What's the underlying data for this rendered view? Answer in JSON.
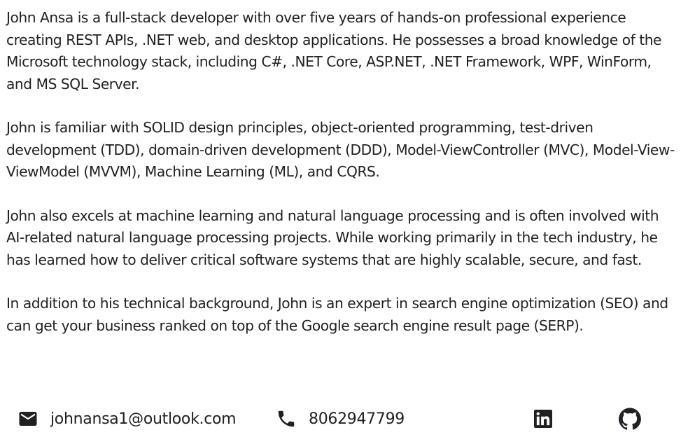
{
  "bio": {
    "paragraphs": [
      "John Ansa is a full-stack developer with over five years of hands-on professional experience creating REST APIs, .NET web, and desktop applications. He possesses a broad knowledge of the Microsoft technology stack, including C#, .NET Core, ASP.NET, .NET Framework, WPF, WinForm, and MS SQL Server.",
      "John is familiar with SOLID design principles, object-oriented programming, test-driven development (TDD), domain-driven development (DDD), Model-ViewController (MVC), Model-View-ViewModel (MVVM), Machine Learning (ML), and CQRS.",
      "John also excels at machine learning and natural language processing and is often involved with AI-related natural language processing projects. While working primarily in the tech industry, he has learned how to deliver critical software systems that are highly scalable, secure, and fast.",
      "In addition to his technical background, John is an expert in search engine optimization (SEO) and can get your business ranked on top of the Google search engine result page (SERP)."
    ]
  },
  "contact": {
    "email": "johnansa1@outlook.com",
    "phone": "8062947799",
    "icons": {
      "email": "mail-icon",
      "phone": "phone-icon",
      "linkedin": "linkedin-icon",
      "github": "github-icon"
    }
  },
  "colors": {
    "text": "#202124",
    "background": "#ffffff"
  }
}
